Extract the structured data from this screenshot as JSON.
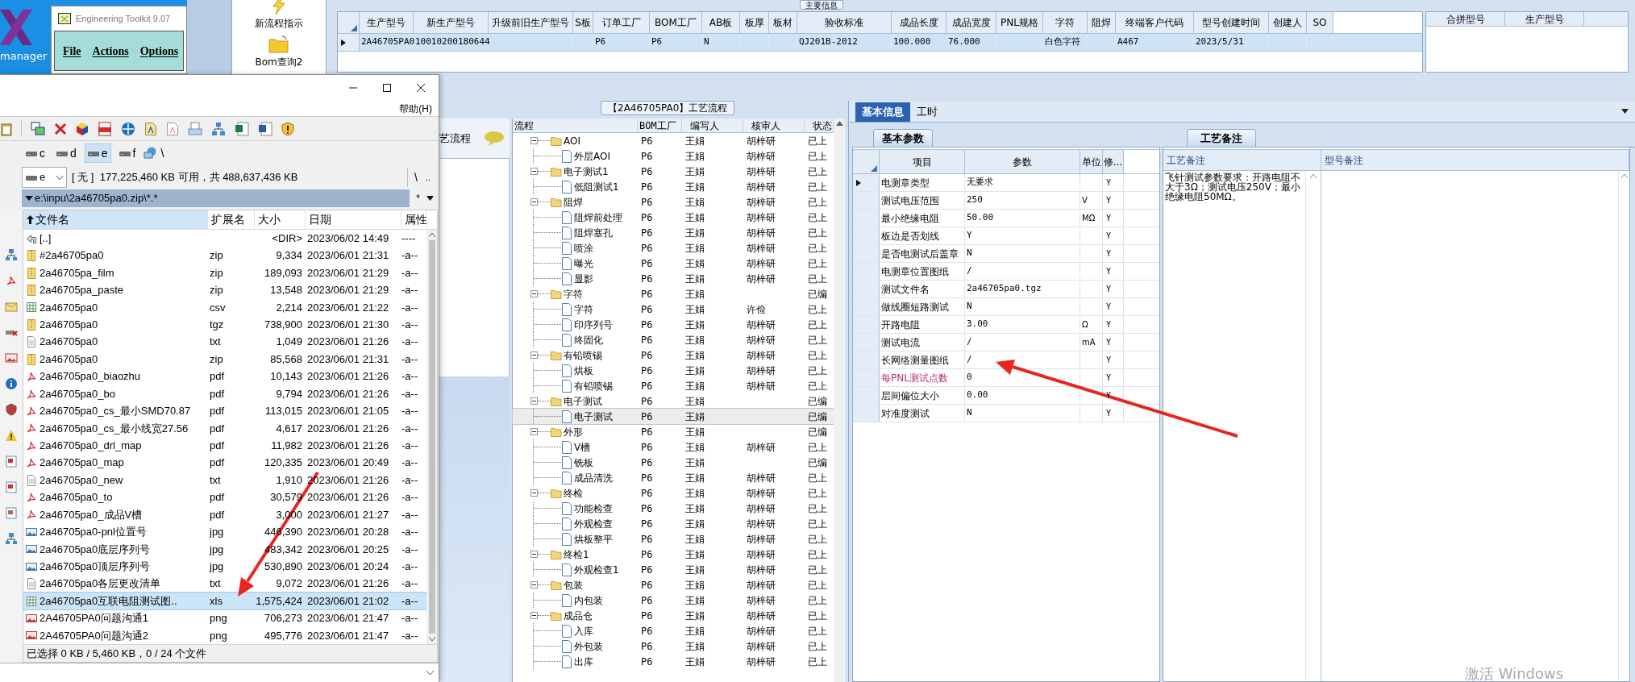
{
  "desktop": {
    "icon_label": "manager",
    "watermark": "激活 Windows"
  },
  "toolkit_window": {
    "title": "Engineering Toolkit 9.07",
    "menu": [
      "File",
      "Actions",
      "Options"
    ]
  },
  "erp": {
    "toolbar": [
      {
        "label": "新流程指示",
        "kind": "lightning"
      },
      {
        "label": "Bom查询2",
        "kind": "folder"
      }
    ],
    "main_info": {
      "title": "主要信息",
      "columns": [
        {
          "label": "生产型号",
          "value": "2A46705PA0"
        },
        {
          "label": "新生产型号",
          "value": "10010200180644"
        },
        {
          "label": "升级前旧生产型号"
        },
        {
          "label": "S板"
        },
        {
          "label": "订单工厂",
          "value": "P6"
        },
        {
          "label": "BOM工厂",
          "value": "P6"
        },
        {
          "label": "AB板",
          "value": "N"
        },
        {
          "label": "板厚"
        },
        {
          "label": "板材"
        },
        {
          "label": "验收标准",
          "value": "QJ201B-2012"
        },
        {
          "label": "成品长度",
          "value": "100.000"
        },
        {
          "label": "成品宽度",
          "value": "76.000"
        },
        {
          "label": "PNL规格"
        },
        {
          "label": "字符",
          "value": "白色字符"
        },
        {
          "label": "阻焊"
        },
        {
          "label": "终端客户代码",
          "value": "A467"
        },
        {
          "label": "型号创建时间",
          "value": "2023/5/31"
        },
        {
          "label": "创建人"
        },
        {
          "label": "SO"
        }
      ],
      "row": {
        "current": true,
        "selected": true
      }
    },
    "merge_grid": {
      "columns": [
        "合拼型号",
        "生产型号"
      ]
    },
    "process": {
      "sidebar_label": "艺流程",
      "title": "【2A46705PA0】工艺流程",
      "columns": [
        "流程",
        "BOM工厂",
        "编写人",
        "核审人",
        "状态"
      ],
      "rows": [
        {
          "name": "AOI",
          "factory": "P6",
          "author": "王娟",
          "reviewer": "胡梓研",
          "status": "已上",
          "expanded": true,
          "selected": false,
          "children": [
            {
              "name": "外层AOI",
              "factory": "P6",
              "author": "王娟",
              "reviewer": "胡梓研",
              "status": "已上",
              "selected": false
            }
          ]
        },
        {
          "name": "电子测试1",
          "factory": "P6",
          "author": "王娟",
          "reviewer": "胡梓研",
          "status": "已上",
          "expanded": true,
          "selected": false,
          "children": [
            {
              "name": "低阻测试1",
              "factory": "P6",
              "author": "王娟",
              "reviewer": "胡梓研",
              "status": "已上",
              "selected": false
            }
          ]
        },
        {
          "name": "阻焊",
          "factory": "P6",
          "author": "王娟",
          "reviewer": "胡梓研",
          "status": "已上",
          "expanded": true,
          "selected": false,
          "children": [
            {
              "name": "阻焊前处理",
              "factory": "P6",
              "author": "王娟",
              "reviewer": "胡梓研",
              "status": "已上",
              "selected": false
            },
            {
              "name": "阻焊塞孔",
              "factory": "P6",
              "author": "王娟",
              "reviewer": "胡梓研",
              "status": "已上",
              "selected": false
            },
            {
              "name": "喷涂",
              "factory": "P6",
              "author": "王娟",
              "reviewer": "胡梓研",
              "status": "已上",
              "selected": false
            },
            {
              "name": "曝光",
              "factory": "P6",
              "author": "王娟",
              "reviewer": "胡梓研",
              "status": "已上",
              "selected": false
            },
            {
              "name": "显影",
              "factory": "P6",
              "author": "王娟",
              "reviewer": "胡梓研",
              "status": "已上",
              "selected": false
            }
          ]
        },
        {
          "name": "字符",
          "factory": "P6",
          "author": "王娟",
          "status": "已编",
          "expanded": true,
          "selected": false,
          "children": [
            {
              "name": "字符",
              "factory": "P6",
              "author": "王娟",
              "reviewer": "许俭",
              "status": "已上",
              "selected": false
            },
            {
              "name": "印序列号",
              "factory": "P6",
              "author": "王娟",
              "reviewer": "胡梓研",
              "status": "已上",
              "selected": false
            },
            {
              "name": "终固化",
              "factory": "P6",
              "author": "王娟",
              "reviewer": "胡梓研",
              "status": "已上",
              "selected": false
            }
          ]
        },
        {
          "name": "有铅喷锡",
          "factory": "P6",
          "author": "王娟",
          "reviewer": "胡梓研",
          "status": "已上",
          "expanded": true,
          "selected": false,
          "children": [
            {
              "name": "烘板",
              "factory": "P6",
              "author": "王娟",
              "reviewer": "胡梓研",
              "status": "已上",
              "selected": false
            },
            {
              "name": "有铅喷锡",
              "factory": "P6",
              "author": "王娟",
              "reviewer": "胡梓研",
              "status": "已上",
              "selected": false
            }
          ]
        },
        {
          "name": "电子测试",
          "factory": "P6",
          "author": "王娟",
          "status": "已编",
          "expanded": true,
          "selected": false,
          "children": [
            {
              "name": "电子测试",
              "factory": "P6",
              "author": "王娟",
              "status": "已编",
              "selected": true
            }
          ]
        },
        {
          "name": "外形",
          "factory": "P6",
          "author": "王娟",
          "status": "已编",
          "expanded": true,
          "selected": false,
          "children": [
            {
              "name": "V槽",
              "factory": "P6",
              "author": "王娟",
              "reviewer": "胡梓研",
              "status": "已上",
              "selected": false
            },
            {
              "name": "铣板",
              "factory": "P6",
              "author": "王娟",
              "status": "已编",
              "selected": false
            },
            {
              "name": "成品清洗",
              "factory": "P6",
              "author": "王娟",
              "reviewer": "胡梓研",
              "status": "已上",
              "selected": false
            }
          ]
        },
        {
          "name": "终检",
          "factory": "P6",
          "author": "王娟",
          "reviewer": "胡梓研",
          "status": "已上",
          "expanded": true,
          "selected": false,
          "children": [
            {
              "name": "功能检查",
              "factory": "P6",
              "author": "王娟",
              "reviewer": "胡梓研",
              "status": "已上",
              "selected": false
            },
            {
              "name": "外观检查",
              "factory": "P6",
              "author": "王娟",
              "reviewer": "胡梓研",
              "status": "已上",
              "selected": false
            },
            {
              "name": "烘板整平",
              "factory": "P6",
              "author": "王娟",
              "reviewer": "胡梓研",
              "status": "已上",
              "selected": false
            }
          ]
        },
        {
          "name": "终检1",
          "factory": "P6",
          "author": "王娟",
          "reviewer": "胡梓研",
          "status": "已上",
          "expanded": true,
          "selected": false,
          "children": [
            {
              "name": "外观检查1",
              "factory": "P6",
              "author": "王娟",
              "reviewer": "胡梓研",
              "status": "已上",
              "selected": false
            }
          ]
        },
        {
          "name": "包装",
          "factory": "P6",
          "author": "王娟",
          "reviewer": "胡梓研",
          "status": "已上",
          "expanded": true,
          "selected": false,
          "children": [
            {
              "name": "内包装",
              "factory": "P6",
              "author": "王娟",
              "reviewer": "胡梓研",
              "status": "已上",
              "selected": false
            }
          ]
        },
        {
          "name": "成品仓",
          "factory": "P6",
          "author": "王娟",
          "reviewer": "胡梓研",
          "status": "已上",
          "expanded": true,
          "selected": false,
          "children": [
            {
              "name": "入库",
              "factory": "P6",
              "author": "王娟",
              "reviewer": "胡梓研",
              "status": "已上",
              "selected": false
            },
            {
              "name": "外包装",
              "factory": "P6",
              "author": "王娟",
              "reviewer": "胡梓研",
              "status": "已上",
              "selected": false
            },
            {
              "name": "出库",
              "factory": "P6",
              "author": "王娟",
              "reviewer": "胡梓研",
              "status": "已上",
              "selected": false
            }
          ]
        }
      ]
    },
    "detail": {
      "tabs": [
        {
          "label": "基本信息",
          "selected": true
        },
        {
          "label": "工时",
          "selected": false
        }
      ],
      "param_tab": "基本参数",
      "param_columns": [
        "项目",
        "参数",
        "单位",
        "修..."
      ],
      "params": [
        {
          "item": "电测章类型",
          "value": "无要求",
          "flag": "Y",
          "current": true,
          "highlighted": false
        },
        {
          "item": "测试电压范围",
          "value": "250",
          "unit": "V",
          "flag": "Y",
          "current": false,
          "highlighted": false
        },
        {
          "item": "最小绝缘电阻",
          "value": "50.00",
          "unit": "MΩ",
          "flag": "Y",
          "current": false,
          "highlighted": false
        },
        {
          "item": "板边是否划线",
          "value": "Y",
          "flag": "Y",
          "current": false,
          "highlighted": false
        },
        {
          "item": "是否电测试后盖章",
          "value": "N",
          "flag": "Y",
          "current": false,
          "highlighted": false
        },
        {
          "item": "电测章位置图纸",
          "value": "/",
          "flag": "Y",
          "current": false,
          "highlighted": false
        },
        {
          "item": "测试文件名",
          "value": "2a46705pa0.tgz",
          "flag": "Y",
          "current": false,
          "highlighted": false
        },
        {
          "item": "做线圈短路测试",
          "value": "N",
          "flag": "Y",
          "current": false,
          "highlighted": false
        },
        {
          "item": "开路电阻",
          "value": "3.00",
          "unit": "Ω",
          "flag": "Y",
          "current": false,
          "highlighted": false
        },
        {
          "item": "测试电流",
          "value": "/",
          "unit": "mA",
          "flag": "Y",
          "current": false,
          "highlighted": false
        },
        {
          "item": "长网络测量图纸",
          "value": "/",
          "flag": "Y",
          "current": false,
          "highlighted": false
        },
        {
          "item": "每PNL测试点数",
          "value": "0",
          "flag": "Y",
          "current": false,
          "highlighted": true
        },
        {
          "item": "层间偏位大小",
          "value": "0.00",
          "flag": "Y",
          "current": false,
          "highlighted": false
        },
        {
          "item": "对准度测试",
          "value": "N",
          "flag": "Y",
          "current": false,
          "highlighted": false
        }
      ],
      "notes_tab": "工艺备注",
      "notes_columns": [
        "工艺备注",
        "型号备注"
      ],
      "process_note": "飞针测试参数要求：开路电阻不大于3Ω；测试电压250V；最小绝缘电阻50MΩ。"
    }
  },
  "file_manager": {
    "menu": [
      "帮助(H)"
    ],
    "drives": [
      {
        "label": "c",
        "selected": false
      },
      {
        "label": "d",
        "selected": false
      },
      {
        "label": "e",
        "selected": true
      },
      {
        "label": "f",
        "selected": false
      }
    ],
    "network_label": "\\",
    "drive_select": "e",
    "drive_info": "[ 无 ]  177,225,460 KB 可用，共 488,637,436 KB",
    "root_button": "\\",
    "parent_button": "..",
    "path": "e:\\inpu\\2a46705pa0.zip\\*.*",
    "filter_button": "*",
    "columns": [
      {
        "label": "文件名",
        "sorted": true
      },
      {
        "label": "扩展名",
        "sorted": false
      },
      {
        "label": "大小",
        "sorted": false
      },
      {
        "label": "日期",
        "sorted": false
      },
      {
        "label": "属性",
        "sorted": false
      }
    ],
    "files": [
      {
        "name": "[..]",
        "kind": "parent",
        "size": "<DIR>",
        "date": "2023/06/02 14:49",
        "attr": "----",
        "selected": false
      },
      {
        "name": "#2a46705pa0",
        "ext": "zip",
        "kind": "archive",
        "size": "9,334",
        "date": "2023/06/01 21:31",
        "attr": "-a--",
        "selected": false
      },
      {
        "name": "2a46705pa_film",
        "ext": "zip",
        "kind": "archive",
        "size": "189,093",
        "date": "2023/06/01 21:29",
        "attr": "-a--",
        "selected": false
      },
      {
        "name": "2a46705pa_paste",
        "ext": "zip",
        "kind": "archive",
        "size": "13,548",
        "date": "2023/06/01 21:29",
        "attr": "-a--",
        "selected": false
      },
      {
        "name": "2a46705pa0",
        "ext": "csv",
        "kind": "sheet",
        "size": "2,214",
        "date": "2023/06/01 21:22",
        "attr": "-a--",
        "selected": false
      },
      {
        "name": "2a46705pa0",
        "ext": "tgz",
        "kind": "archive",
        "size": "738,900",
        "date": "2023/06/01 21:30",
        "attr": "-a--",
        "selected": false
      },
      {
        "name": "2a46705pa0",
        "ext": "txt",
        "kind": "text",
        "size": "1,049",
        "date": "2023/06/01 21:26",
        "attr": "-a--",
        "selected": false
      },
      {
        "name": "2a46705pa0",
        "ext": "zip",
        "kind": "archive",
        "size": "85,568",
        "date": "2023/06/01 21:31",
        "attr": "-a--",
        "selected": false
      },
      {
        "name": "2a46705pa0_biaozhu",
        "ext": "pdf",
        "kind": "pdf",
        "size": "10,143",
        "date": "2023/06/01 21:26",
        "attr": "-a--",
        "selected": false
      },
      {
        "name": "2a46705pa0_bo",
        "ext": "pdf",
        "kind": "pdf",
        "size": "9,794",
        "date": "2023/06/01 21:26",
        "attr": "-a--",
        "selected": false
      },
      {
        "name": "2a46705pa0_cs_最小SMD70.87",
        "ext": "pdf",
        "kind": "pdf",
        "size": "113,015",
        "date": "2023/06/01 21:05",
        "attr": "-a--",
        "selected": false
      },
      {
        "name": "2a46705pa0_cs_最小线宽27.56",
        "ext": "pdf",
        "kind": "pdf",
        "size": "4,617",
        "date": "2023/06/01 21:26",
        "attr": "-a--",
        "selected": false
      },
      {
        "name": "2a46705pa0_drl_map",
        "ext": "pdf",
        "kind": "pdf",
        "size": "11,982",
        "date": "2023/06/01 21:26",
        "attr": "-a--",
        "selected": false
      },
      {
        "name": "2a46705pa0_map",
        "ext": "pdf",
        "kind": "pdf",
        "size": "120,335",
        "date": "2023/06/01 20:49",
        "attr": "-a--",
        "selected": false
      },
      {
        "name": "2a46705pa0_new",
        "ext": "txt",
        "kind": "text",
        "size": "1,910",
        "date": "2023/06/01 21:26",
        "attr": "-a--",
        "selected": false
      },
      {
        "name": "2a46705pa0_to",
        "ext": "pdf",
        "kind": "pdf",
        "size": "30,579",
        "date": "2023/06/01 21:26",
        "attr": "-a--",
        "selected": false
      },
      {
        "name": "2a46705pa0_成品V槽",
        "ext": "pdf",
        "kind": "pdf",
        "size": "3,000",
        "date": "2023/06/01 21:27",
        "attr": "-a--",
        "selected": false
      },
      {
        "name": "2a46705pa0-pnl位置号",
        "ext": "jpg",
        "kind": "image",
        "size": "446,390",
        "date": "2023/06/01 20:28",
        "attr": "-a--",
        "selected": false
      },
      {
        "name": "2a46705pa0底层序列号",
        "ext": "jpg",
        "kind": "image",
        "size": "483,342",
        "date": "2023/06/01 20:25",
        "attr": "-a--",
        "selected": false
      },
      {
        "name": "2a46705pa0顶层序列号",
        "ext": "jpg",
        "kind": "image",
        "size": "530,890",
        "date": "2023/06/01 20:24",
        "attr": "-a--",
        "selected": false
      },
      {
        "name": "2a46705pa0各层更改清单",
        "ext": "txt",
        "kind": "text",
        "size": "9,072",
        "date": "2023/06/01 21:26",
        "attr": "-a--",
        "selected": false
      },
      {
        "name": "2a46705pa0互联电阻测试图..",
        "ext": "xls",
        "kind": "sheet",
        "size": "1,575,424",
        "date": "2023/06/01 21:02",
        "attr": "-a--",
        "selected": true
      },
      {
        "name": "2A46705PA0问题沟通1",
        "ext": "png",
        "kind": "screenshot",
        "size": "706,273",
        "date": "2023/06/01 21:47",
        "attr": "-a--",
        "selected": false
      },
      {
        "name": "2A46705PA0问题沟通2",
        "ext": "png",
        "kind": "screenshot",
        "size": "495,776",
        "date": "2023/06/01 21:47",
        "attr": "-a--",
        "selected": false
      }
    ],
    "status": "已选择 0 KB / 5,460 KB，0 / 24 个文件"
  }
}
